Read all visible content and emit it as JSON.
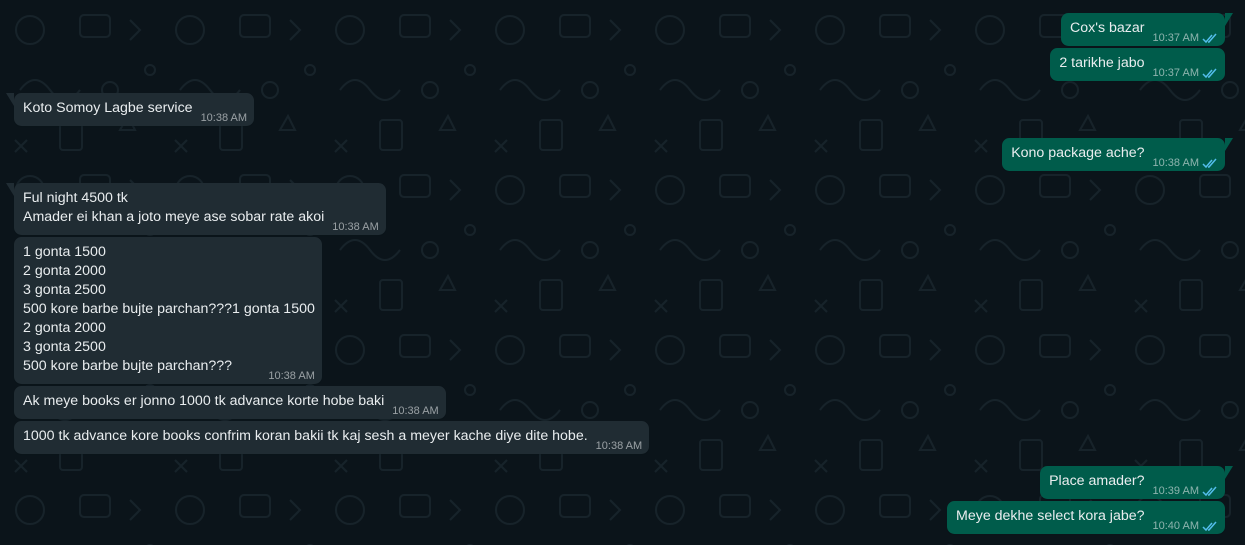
{
  "colors": {
    "background": "#0b141a",
    "incoming_bubble": "#202c33",
    "outgoing_bubble": "#005c4b",
    "text": "#e9edef",
    "read_ticks": "#53bdeb"
  },
  "messages": [
    {
      "direction": "out",
      "text": "Cox's bazar",
      "time": "10:37 AM",
      "status": "read"
    },
    {
      "direction": "out",
      "text": "2 tarikhe jabo",
      "time": "10:37 AM",
      "status": "read"
    },
    {
      "direction": "in",
      "text": "Koto Somoy Lagbe service",
      "time": "10:38 AM"
    },
    {
      "direction": "out",
      "text": "Kono package ache?",
      "time": "10:38 AM",
      "status": "read"
    },
    {
      "direction": "in",
      "text": "Ful night 4500 tk\nAmader ei khan a joto meye ase sobar rate akoi",
      "time": "10:38 AM"
    },
    {
      "direction": "in",
      "text": "1 gonta 1500\n2 gonta 2000\n3 gonta 2500\n500 kore barbe bujte parchan???1 gonta 1500\n2 gonta 2000\n3 gonta 2500\n500 kore barbe bujte parchan???",
      "time": "10:38 AM"
    },
    {
      "direction": "in",
      "text": "Ak meye books er jonno 1000 tk advance korte hobe baki",
      "time": "10:38 AM"
    },
    {
      "direction": "in",
      "text": "1000 tk advance kore books confrim koran bakii tk kaj sesh a meyer kache diye dite hobe.",
      "time": "10:38 AM"
    },
    {
      "direction": "out",
      "text": "Place amader?",
      "time": "10:39 AM",
      "status": "read"
    },
    {
      "direction": "out",
      "text": "Meye dekhe select kora jabe?",
      "time": "10:40 AM",
      "status": "read"
    }
  ]
}
